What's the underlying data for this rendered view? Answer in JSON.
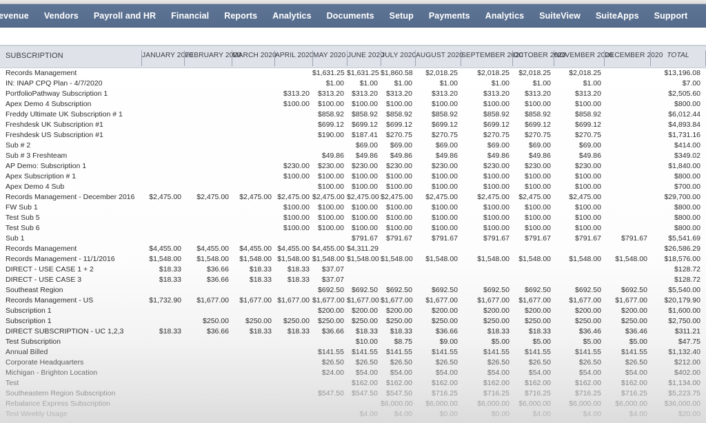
{
  "navbar": {
    "items": [
      {
        "label": "Revenue",
        "clipped": true
      },
      {
        "label": "Vendors"
      },
      {
        "label": "Payroll and HR"
      },
      {
        "label": "Financial"
      },
      {
        "label": "Reports"
      },
      {
        "label": "Analytics"
      },
      {
        "label": "Documents"
      },
      {
        "label": "Setup"
      },
      {
        "label": "Payments"
      },
      {
        "label": "Analytics"
      },
      {
        "label": "SuiteView"
      },
      {
        "label": "SuiteApps"
      },
      {
        "label": "Support"
      }
    ]
  },
  "report": {
    "columns": [
      "SUBSCRIPTION",
      "JANUARY 2020",
      "FEBRUARY 2020",
      "MARCH 2020",
      "APRIL 2020",
      "MAY 2020",
      "JUNE 2020",
      "JULY 2020",
      "AUGUST 2020",
      "SEPTEMBER 2020",
      "OCTOBER 2020",
      "NOVEMBER 2020",
      "DECEMBER 2020",
      "TOTAL"
    ],
    "rows": [
      {
        "label": "Records Management",
        "values": [
          "",
          "",
          "",
          "",
          "$1,631.25",
          "$1,631.25",
          "$1,860.58",
          "$2,018.25",
          "$2,018.25",
          "$2,018.25",
          "$2,018.25",
          "",
          "$13,196.08"
        ]
      },
      {
        "label": "IN: INAP CPQ Plan - 4/7/2020",
        "values": [
          "",
          "",
          "",
          "",
          "$1.00",
          "$1.00",
          "$1.00",
          "$1.00",
          "$1.00",
          "$1.00",
          "$1.00",
          "",
          "$7.00"
        ]
      },
      {
        "label": "PortfolioPathway Subscription 1",
        "values": [
          "",
          "",
          "",
          "$313.20",
          "$313.20",
          "$313.20",
          "$313.20",
          "$313.20",
          "$313.20",
          "$313.20",
          "$313.20",
          "",
          "$2,505.60"
        ]
      },
      {
        "label": "Apex Demo 4 Subscription",
        "values": [
          "",
          "",
          "",
          "$100.00",
          "$100.00",
          "$100.00",
          "$100.00",
          "$100.00",
          "$100.00",
          "$100.00",
          "$100.00",
          "",
          "$800.00"
        ]
      },
      {
        "label": "Freddy Ultimate UK Subscription # 1",
        "values": [
          "",
          "",
          "",
          "",
          "$858.92",
          "$858.92",
          "$858.92",
          "$858.92",
          "$858.92",
          "$858.92",
          "$858.92",
          "",
          "$6,012.44"
        ]
      },
      {
        "label": "Freshdesk UK Subscription #1",
        "values": [
          "",
          "",
          "",
          "",
          "$699.12",
          "$699.12",
          "$699.12",
          "$699.12",
          "$699.12",
          "$699.12",
          "$699.12",
          "",
          "$4,893.84"
        ]
      },
      {
        "label": "Freshdesk US Subscription #1",
        "values": [
          "",
          "",
          "",
          "",
          "$190.00",
          "$187.41",
          "$270.75",
          "$270.75",
          "$270.75",
          "$270.75",
          "$270.75",
          "",
          "$1,731.16"
        ]
      },
      {
        "label": "Sub # 2",
        "values": [
          "",
          "",
          "",
          "",
          "",
          "$69.00",
          "$69.00",
          "$69.00",
          "$69.00",
          "$69.00",
          "$69.00",
          "",
          "$414.00"
        ]
      },
      {
        "label": "Sub # 3 Freshteam",
        "values": [
          "",
          "",
          "",
          "",
          "$49.86",
          "$49.86",
          "$49.86",
          "$49.86",
          "$49.86",
          "$49.86",
          "$49.86",
          "",
          "$349.02"
        ]
      },
      {
        "label": "AP Demo: Subscription 1",
        "values": [
          "",
          "",
          "",
          "$230.00",
          "$230.00",
          "$230.00",
          "$230.00",
          "$230.00",
          "$230.00",
          "$230.00",
          "$230.00",
          "",
          "$1,840.00"
        ]
      },
      {
        "label": "Apex Subscription # 1",
        "values": [
          "",
          "",
          "",
          "$100.00",
          "$100.00",
          "$100.00",
          "$100.00",
          "$100.00",
          "$100.00",
          "$100.00",
          "$100.00",
          "",
          "$800.00"
        ]
      },
      {
        "label": "Apex Demo 4 Sub",
        "values": [
          "",
          "",
          "",
          "",
          "$100.00",
          "$100.00",
          "$100.00",
          "$100.00",
          "$100.00",
          "$100.00",
          "$100.00",
          "",
          "$700.00"
        ]
      },
      {
        "label": "Records Management - December 2016",
        "values": [
          "$2,475.00",
          "$2,475.00",
          "$2,475.00",
          "$2,475.00",
          "$2,475.00",
          "$2,475.00",
          "$2,475.00",
          "$2,475.00",
          "$2,475.00",
          "$2,475.00",
          "$2,475.00",
          "",
          "$29,700.00"
        ]
      },
      {
        "label": "FW Sub 1",
        "values": [
          "",
          "",
          "",
          "$100.00",
          "$100.00",
          "$100.00",
          "$100.00",
          "$100.00",
          "$100.00",
          "$100.00",
          "$100.00",
          "",
          "$800.00"
        ]
      },
      {
        "label": "Test Sub 5",
        "values": [
          "",
          "",
          "",
          "$100.00",
          "$100.00",
          "$100.00",
          "$100.00",
          "$100.00",
          "$100.00",
          "$100.00",
          "$100.00",
          "",
          "$800.00"
        ]
      },
      {
        "label": "Test Sub 6",
        "values": [
          "",
          "",
          "",
          "$100.00",
          "$100.00",
          "$100.00",
          "$100.00",
          "$100.00",
          "$100.00",
          "$100.00",
          "$100.00",
          "",
          "$800.00"
        ]
      },
      {
        "label": "Sub 1",
        "values": [
          "",
          "",
          "",
          "",
          "",
          "$791.67",
          "$791.67",
          "$791.67",
          "$791.67",
          "$791.67",
          "$791.67",
          "$791.67",
          "$5,541.69"
        ]
      },
      {
        "label": "Records Management",
        "values": [
          "$4,455.00",
          "$4,455.00",
          "$4,455.00",
          "$4,455.00",
          "$4,455.00",
          "$4,311.29",
          "",
          "",
          "",
          "",
          "",
          "",
          "$26,586.29"
        ]
      },
      {
        "label": "Records Management - 11/1/2016",
        "values": [
          "$1,548.00",
          "$1,548.00",
          "$1,548.00",
          "$1,548.00",
          "$1,548.00",
          "$1,548.00",
          "$1,548.00",
          "$1,548.00",
          "$1,548.00",
          "$1,548.00",
          "$1,548.00",
          "$1,548.00",
          "$18,576.00"
        ]
      },
      {
        "label": "DIRECT - USE CASE 1 + 2",
        "values": [
          "$18.33",
          "$36.66",
          "$18.33",
          "$18.33",
          "$37.07",
          "",
          "",
          "",
          "",
          "",
          "",
          "",
          "$128.72"
        ]
      },
      {
        "label": "DIRECT - USE CASE 3",
        "values": [
          "$18.33",
          "$36.66",
          "$18.33",
          "$18.33",
          "$37.07",
          "",
          "",
          "",
          "",
          "",
          "",
          "",
          "$128.72"
        ]
      },
      {
        "label": "Southeast Region",
        "values": [
          "",
          "",
          "",
          "",
          "$692.50",
          "$692.50",
          "$692.50",
          "$692.50",
          "$692.50",
          "$692.50",
          "$692.50",
          "$692.50",
          "$5,540.00"
        ]
      },
      {
        "label": "Records Management - US",
        "values": [
          "$1,732.90",
          "$1,677.00",
          "$1,677.00",
          "$1,677.00",
          "$1,677.00",
          "$1,677.00",
          "$1,677.00",
          "$1,677.00",
          "$1,677.00",
          "$1,677.00",
          "$1,677.00",
          "$1,677.00",
          "$20,179.90"
        ]
      },
      {
        "label": "Subscription 1",
        "values": [
          "",
          "",
          "",
          "",
          "$200.00",
          "$200.00",
          "$200.00",
          "$200.00",
          "$200.00",
          "$200.00",
          "$200.00",
          "$200.00",
          "$1,600.00"
        ]
      },
      {
        "label": "Subscription 1",
        "values": [
          "",
          "$250.00",
          "$250.00",
          "$250.00",
          "$250.00",
          "$250.00",
          "$250.00",
          "$250.00",
          "$250.00",
          "$250.00",
          "$250.00",
          "$250.00",
          "$2,750.00"
        ]
      },
      {
        "label": "DIRECT SUBSCRIPTION - UC 1,2,3",
        "values": [
          "$18.33",
          "$36.66",
          "$18.33",
          "$18.33",
          "$36.66",
          "$18.33",
          "$18.33",
          "$36.66",
          "$18.33",
          "$18.33",
          "$36.46",
          "$36.46",
          "$311.21"
        ]
      },
      {
        "label": "Test Subscription",
        "values": [
          "",
          "",
          "",
          "",
          "",
          "$10.00",
          "$8.75",
          "$9.00",
          "$5.00",
          "$5.00",
          "$5.00",
          "$5.00",
          "$47.75"
        ]
      },
      {
        "label": "Annual Billed",
        "values": [
          "",
          "",
          "",
          "",
          "$141.55",
          "$141.55",
          "$141.55",
          "$141.55",
          "$141.55",
          "$141.55",
          "$141.55",
          "$141.55",
          "$1,132.40"
        ]
      },
      {
        "label": "Corporate Headquarters",
        "values": [
          "",
          "",
          "",
          "",
          "$26.50",
          "$26.50",
          "$26.50",
          "$26.50",
          "$26.50",
          "$26.50",
          "$26.50",
          "$26.50",
          "$212.00"
        ]
      },
      {
        "label": "Michigan - Brighton Location",
        "values": [
          "",
          "",
          "",
          "",
          "$24.00",
          "$54.00",
          "$54.00",
          "$54.00",
          "$54.00",
          "$54.00",
          "$54.00",
          "$54.00",
          "$402.00"
        ]
      },
      {
        "label": "Test",
        "values": [
          "",
          "",
          "",
          "",
          "",
          "$162.00",
          "$162.00",
          "$162.00",
          "$162.00",
          "$162.00",
          "$162.00",
          "$162.00",
          "$1,134.00"
        ]
      },
      {
        "label": "Southeastern Region Subscription",
        "values": [
          "",
          "",
          "",
          "",
          "$547.50",
          "$547.50",
          "$547.50",
          "$716.25",
          "$716.25",
          "$716.25",
          "$716.25",
          "$716.25",
          "$5,223.75"
        ]
      },
      {
        "label": "Rebalance Express Subscription",
        "values": [
          "",
          "",
          "",
          "",
          "",
          "",
          "$6,000.00",
          "$6,000.00",
          "$6,000.00",
          "$6,000.00",
          "$6,000.00",
          "$6,000.00",
          "$36,000.00"
        ]
      },
      {
        "label": "Test Weekly Usage",
        "values": [
          "",
          "",
          "",
          "",
          "",
          "$4.00",
          "$4.00",
          "$0.00",
          "$0.00",
          "$4.00",
          "$4.00",
          "$4.00",
          "$20.00"
        ]
      }
    ]
  }
}
